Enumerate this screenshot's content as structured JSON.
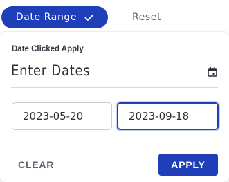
{
  "tabs": {
    "date_range_label": "Date Range",
    "reset_label": "Reset"
  },
  "panel": {
    "subtitle": "Date Clicked Apply",
    "heading": "Enter Dates",
    "calendar_icon": "calendar-icon"
  },
  "inputs": {
    "start_date": "2023-05-20",
    "end_date": "2023-09-18"
  },
  "actions": {
    "clear_label": "CLEAR",
    "apply_label": "APPLY"
  },
  "colors": {
    "accent": "#1f3fb8",
    "focus_ring": "#c7d1f3",
    "muted_text": "#5b6272"
  }
}
